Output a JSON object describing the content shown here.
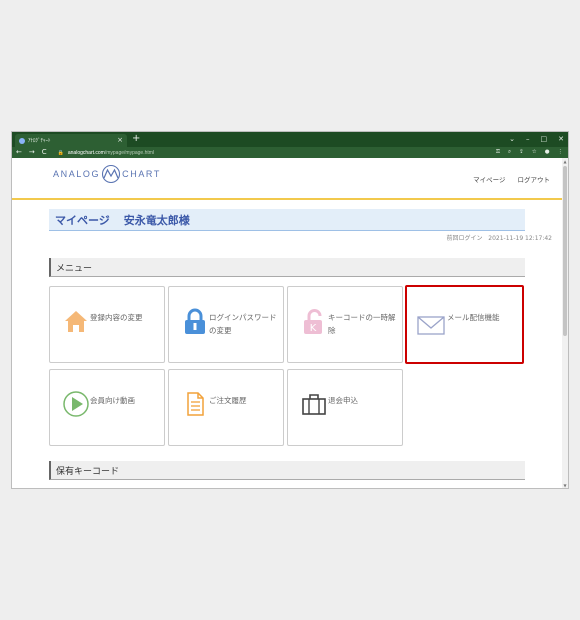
{
  "browser": {
    "tab_title": "ｱﾅﾛｸﾞﾁｬｰﾄ",
    "tab_close": "×",
    "new_tab": "+",
    "url_host": "analogchart.com",
    "url_path": "/mypage/mypage.html"
  },
  "site": {
    "logo_left": "ANALOG",
    "logo_right": "CHART",
    "nav": {
      "mypage": "マイページ",
      "logout": "ログアウト"
    }
  },
  "page": {
    "title": "マイページ",
    "user": "安永竜太郎様",
    "last_login_label": "前回ログイン",
    "last_login_time": "2021-11-19 12:17:42"
  },
  "menu": {
    "header": "メニュー",
    "items": [
      {
        "label": "登録内容の変更",
        "icon": "house-icon",
        "color": "#f5b877"
      },
      {
        "label": "ログインパスワードの変更",
        "icon": "lock-icon",
        "color": "#4a90d9"
      },
      {
        "label": "キーコードの一時解除",
        "icon": "keycode-lock-icon",
        "color": "#e98ab5"
      },
      {
        "label": "メール配信機能",
        "icon": "envelope-icon",
        "color": "#9aa3c9"
      },
      {
        "label": "会員向け動画",
        "icon": "play-icon",
        "color": "#79b86c"
      },
      {
        "label": "ご注文履歴",
        "icon": "document-icon",
        "color": "#f2a23a"
      },
      {
        "label": "退会申込",
        "icon": "briefcase-icon",
        "color": "#444444"
      }
    ]
  },
  "keycode": {
    "header": "保有キーコード"
  }
}
